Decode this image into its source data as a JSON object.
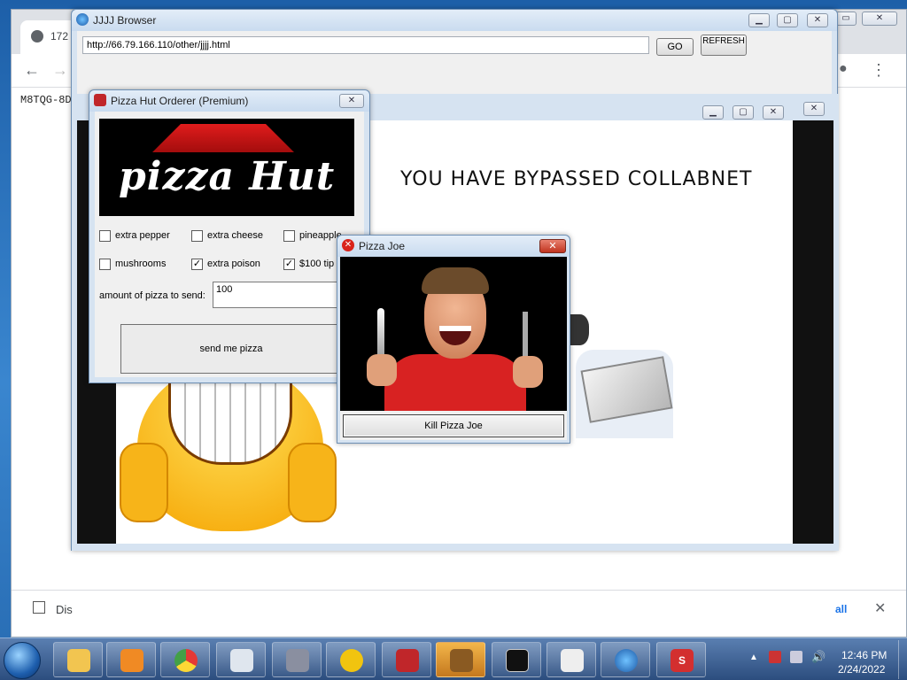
{
  "chrome": {
    "tab_title": "172",
    "content_text": "M8TQG-8D",
    "download_text": "Dis",
    "show_all": "all"
  },
  "jjjj_browser": {
    "title": "JJJJ Browser",
    "url": "http://66.79.166.110/other/jjjj.html",
    "go_label": "GO",
    "refresh_label": "REFRESH",
    "page_heading": "YOU HAVE BYPASSED COLLABNET"
  },
  "orderer": {
    "title": "Pizza Hut Orderer (Premium)",
    "logo_text": "pizza Hut",
    "options": [
      {
        "label": "extra pepper",
        "checked": false
      },
      {
        "label": "extra cheese",
        "checked": false
      },
      {
        "label": "pineapple",
        "checked": false
      },
      {
        "label": "mushrooms",
        "checked": false
      },
      {
        "label": "extra poison",
        "checked": true
      },
      {
        "label": "$100 tip",
        "checked": true
      }
    ],
    "amount_label": "amount of pizza to send:",
    "amount_value": "100",
    "send_label": "send me pizza"
  },
  "pizza_joe": {
    "title": "Pizza Joe",
    "kill_label": "Kill Pizza Joe"
  },
  "taskbar": {
    "time": "12:46 PM",
    "date": "2/24/2022",
    "apps": [
      "explorer",
      "media-player",
      "chrome",
      "window",
      "computer",
      "stethoscope",
      "phone",
      "package",
      "cmd",
      "java",
      "globe",
      "s-app"
    ]
  }
}
